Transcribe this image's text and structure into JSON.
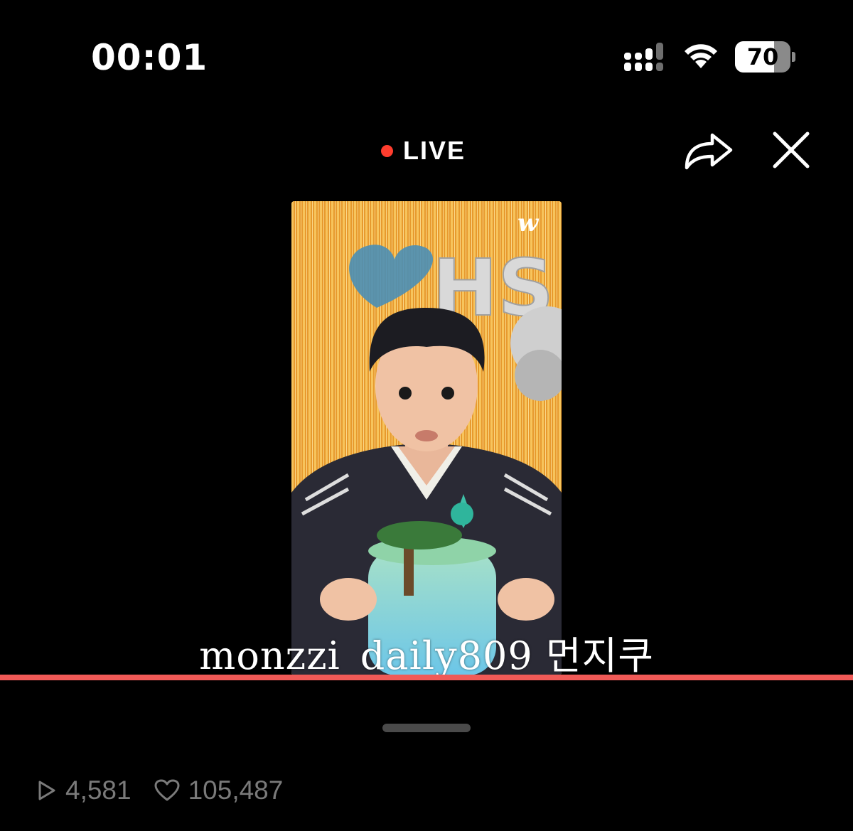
{
  "status_bar": {
    "time": "00:01",
    "battery_percent": "70",
    "battery_level": 0.7
  },
  "player": {
    "live_label": "LIVE",
    "share_icon": "share-arrow-icon",
    "close_icon": "close-icon",
    "brand_watermark": "w",
    "watermark_text": "monzzi_daily809 먼지쿠",
    "progress_fraction": 1.0
  },
  "stats": {
    "play_count": "4,581",
    "like_count": "105,487",
    "play_icon": "play-icon",
    "like_icon": "heart-icon"
  },
  "colors": {
    "live_dot": "#ff3d2e",
    "progress": "#f05a57",
    "muted_text": "#7a7a7a"
  }
}
